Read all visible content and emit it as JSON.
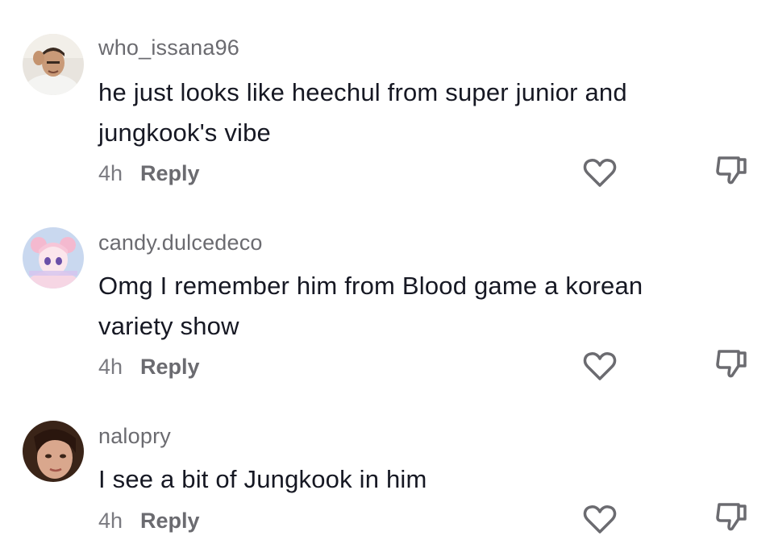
{
  "comments": [
    {
      "username": "who_issana96",
      "text": "he just looks like heechul from super junior and jungkook's vibe",
      "time": "4h",
      "reply_label": "Reply",
      "avatar_icon": "user-photo-avatar"
    },
    {
      "username": "candy.dulcedeco",
      "text": "Omg I remember him from Blood game a korean variety show",
      "time": "4h",
      "reply_label": "Reply",
      "avatar_icon": "anime-character-avatar"
    },
    {
      "username": "nalopry",
      "text": "I see a bit of Jungkook in him",
      "time": "4h",
      "reply_label": "Reply",
      "avatar_icon": "user-photo-avatar"
    }
  ],
  "icons": {
    "like": "heart-icon",
    "dislike": "thumbs-down-icon"
  },
  "colors": {
    "text": "#161823",
    "secondary": "#6b6b70",
    "icon": "#6b6b70",
    "background": "#ffffff"
  }
}
